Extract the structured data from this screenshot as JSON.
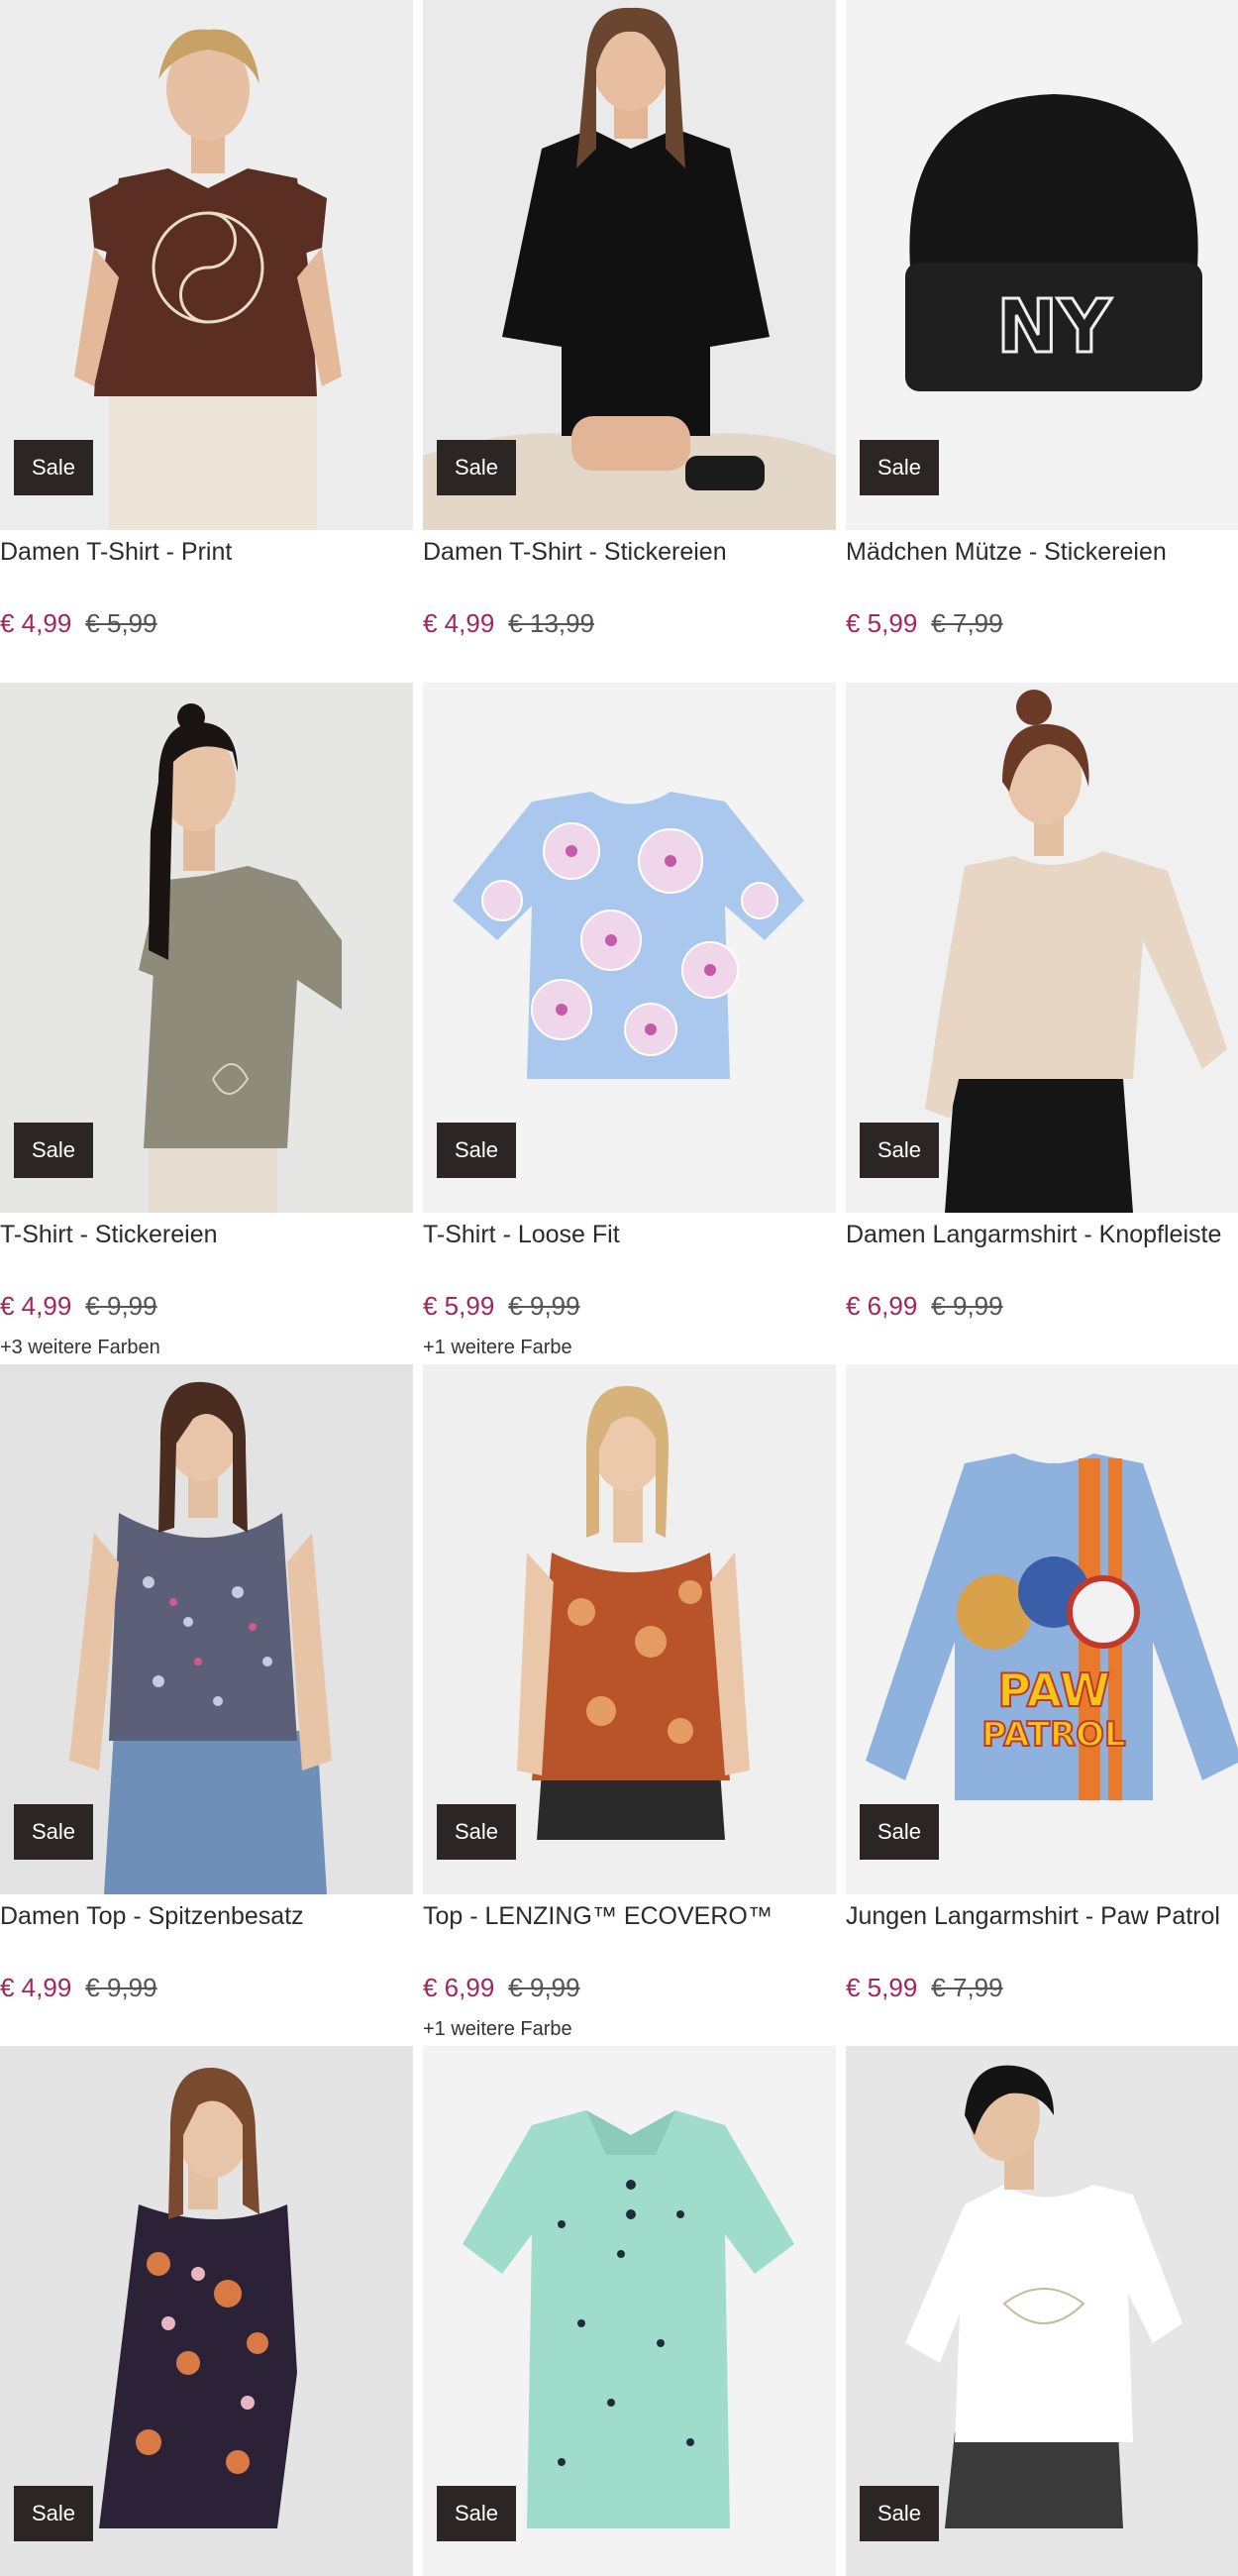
{
  "badge_label": "Sale",
  "products": [
    {
      "title": "Damen T-Shirt - Print",
      "price": "€ 4,99",
      "old_price": "€ 5,99",
      "colors": ""
    },
    {
      "title": "Damen T-Shirt - Stickereien",
      "price": "€ 4,99",
      "old_price": "€ 13,99",
      "colors": ""
    },
    {
      "title": "Mädchen Mütze - Stickereien",
      "price": "€ 5,99",
      "old_price": "€ 7,99",
      "colors": ""
    },
    {
      "title": "T-Shirt - Stickereien",
      "price": "€ 4,99",
      "old_price": "€ 9,99",
      "colors": "+3 weitere Farben"
    },
    {
      "title": "T-Shirt - Loose Fit",
      "price": "€ 5,99",
      "old_price": "€ 9,99",
      "colors": "+1 weitere Farbe"
    },
    {
      "title": "Damen Langarmshirt - Knopfleiste",
      "price": "€ 6,99",
      "old_price": "€ 9,99",
      "colors": ""
    },
    {
      "title": "Damen Top - Spitzenbesatz",
      "price": "€ 4,99",
      "old_price": "€ 9,99",
      "colors": ""
    },
    {
      "title": "Top - LENZING™ ECOVERO™",
      "price": "€ 6,99",
      "old_price": "€ 9,99",
      "colors": "+1 weitere Farbe"
    },
    {
      "title": "Jungen Langarmshirt - Paw Patrol",
      "price": "€ 5,99",
      "old_price": "€ 7,99",
      "colors": ""
    },
    {
      "title": "",
      "price": "",
      "old_price": "",
      "colors": ""
    },
    {
      "title": "",
      "price": "",
      "old_price": "",
      "colors": ""
    },
    {
      "title": "",
      "price": "",
      "old_price": "",
      "colors": ""
    }
  ],
  "image_text": {
    "beanie_logo": "NY",
    "paw_logo_1": "PAW",
    "paw_logo_2": "PATROL"
  },
  "colors": {
    "sale_badge": "#2b2523",
    "price": "#a3265b",
    "old_price": "#555555",
    "image_bg": "#ececec"
  }
}
